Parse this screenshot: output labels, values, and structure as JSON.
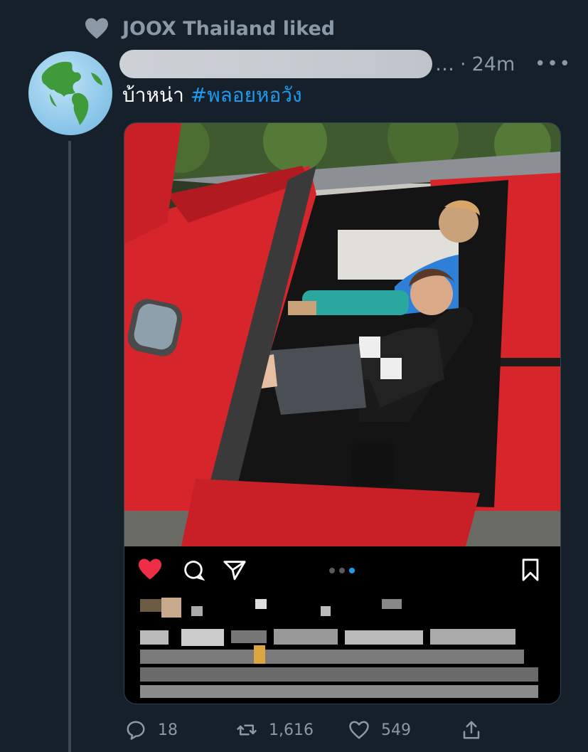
{
  "social_context": {
    "icon": "heart-icon",
    "text": "JOOX Thailand liked"
  },
  "tweet": {
    "time": "24m",
    "ellipsis": "…",
    "separator": "·",
    "more": "•••",
    "text": "บ้าหน่า",
    "hashtag": "#พลอยหอวัง"
  },
  "actions": {
    "reply_count": "18",
    "retweet_count": "1,616",
    "like_count": "549"
  },
  "colors": {
    "background": "#15202b",
    "accent": "#1d9bf0",
    "muted": "#8b98a5",
    "car_red": "#d6252b"
  }
}
